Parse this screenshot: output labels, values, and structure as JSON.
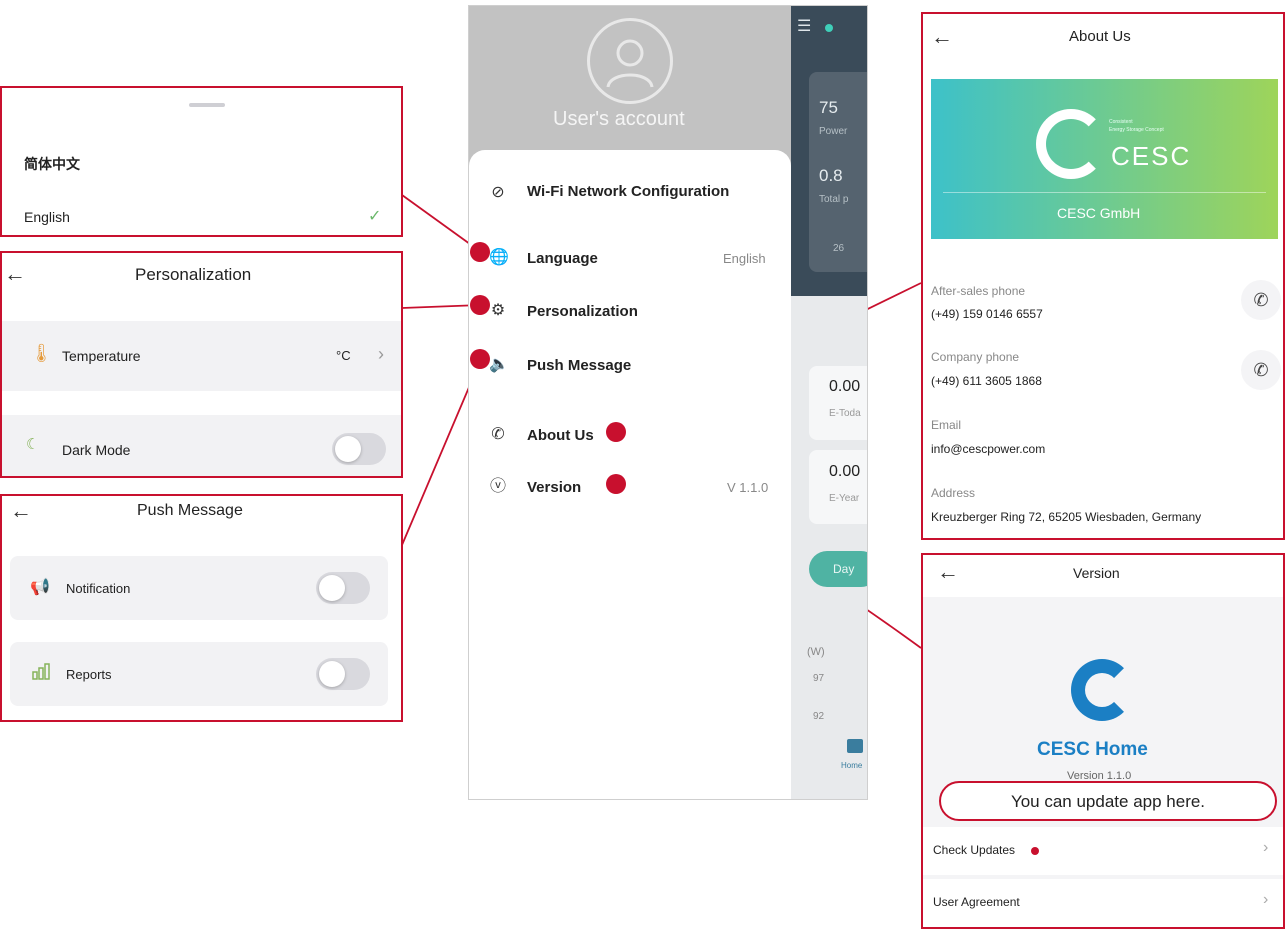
{
  "language_sheet": {
    "options": [
      "简体中文",
      "English"
    ],
    "selected_mark": "✓"
  },
  "personalization": {
    "title": "Personalization",
    "temperature_label": "Temperature",
    "temperature_value": "°C",
    "dark_mode_label": "Dark Mode"
  },
  "push_message": {
    "title": "Push Message",
    "notification_label": "Notification",
    "reports_label": "Reports"
  },
  "drawer": {
    "account_label": "User's account",
    "items": [
      {
        "label": "Wi-Fi Network Configuration",
        "value": ""
      },
      {
        "label": "Language",
        "value": "English"
      },
      {
        "label": "Personalization",
        "value": ""
      },
      {
        "label": "Push Message",
        "value": ""
      },
      {
        "label": "About Us",
        "value": ""
      },
      {
        "label": "Version",
        "value": "V 1.1.0"
      }
    ]
  },
  "background_app": {
    "stats": [
      "75",
      "Power",
      "0.8",
      "Total p",
      "26"
    ],
    "cards": [
      "0.00",
      "E-Toda",
      "0.00",
      "E-Year"
    ],
    "day_button": "Day",
    "chart_unit": "(W)",
    "chart_ticks": [
      "97",
      "92"
    ],
    "home_label": "Home"
  },
  "about_us": {
    "title": "About Us",
    "brand_logo_text": "CESC",
    "brand_small_lines": [
      "Consistent",
      "Energy Storage Concept"
    ],
    "company_name": "CESC GmbH",
    "after_sales_label": "After-sales phone",
    "after_sales_value": "(+49) 159 0146 6557",
    "company_phone_label": "Company phone",
    "company_phone_value": "(+49) 611 3605 1868",
    "email_label": "Email",
    "email_value": "info@cescpower.com",
    "address_label": "Address",
    "address_value": "Kreuzberger Ring 72, 65205 Wiesbaden, Germany"
  },
  "version": {
    "title": "Version",
    "app_name": "CESC Home",
    "version_text": "Version 1.1.0",
    "callout": "You can update app here.",
    "check_updates": "Check Updates",
    "user_agreement": "User Agreement",
    "chevron": "›"
  },
  "colors": {
    "accent_red": "#c8102e",
    "brand_blue": "#1b7fc4",
    "brand_gradient_start": "#3dc1c9",
    "brand_gradient_end": "#9ed45a"
  }
}
